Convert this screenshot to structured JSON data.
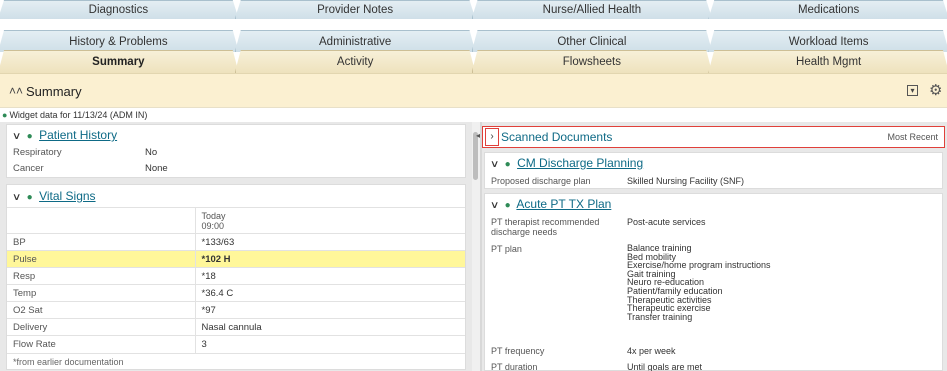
{
  "tabs": {
    "row1": [
      "Diagnostics",
      "Provider Notes",
      "Nurse/Allied Health",
      "Medications"
    ],
    "row2": [
      "History & Problems",
      "Administrative",
      "Other Clinical",
      "Workload Items"
    ],
    "row3": [
      "Summary",
      "Activity",
      "Flowsheets",
      "Health Mgmt"
    ]
  },
  "summary": {
    "title": "Summary",
    "collapse_icon": "chevron-double-up-icon",
    "refresh_icon": "refresh-icon",
    "settings_icon": "gear-icon"
  },
  "widget_date": "Widget data for 11/13/24 (ADM IN)",
  "patient_history": {
    "title": "Patient History",
    "rows": [
      {
        "label": "Respiratory",
        "value": "No"
      },
      {
        "label": "Cancer",
        "value": "None"
      }
    ]
  },
  "vital_signs": {
    "title": "Vital Signs",
    "col_header_day": "Today",
    "col_header_time": "09:00",
    "rows": [
      {
        "label": "BP",
        "value": "*133/63"
      },
      {
        "label": "Pulse",
        "value": "*102 H"
      },
      {
        "label": "Resp",
        "value": "*18"
      },
      {
        "label": "Temp",
        "value": "*36.4 C"
      },
      {
        "label": "O2 Sat",
        "value": "*97"
      },
      {
        "label": "Delivery",
        "value": "Nasal cannula"
      },
      {
        "label": "Flow Rate",
        "value": "3"
      }
    ],
    "footnote": "*from earlier documentation"
  },
  "scanned_documents": {
    "title": "Scanned Documents",
    "sort_label": "Most Recent"
  },
  "cm_discharge": {
    "title": "CM Discharge Planning",
    "label": "Proposed discharge plan",
    "value": "Skilled Nursing Facility (SNF)"
  },
  "acute_pt": {
    "title": "Acute PT TX Plan",
    "needs_label": "PT therapist recommended discharge needs",
    "needs_value": "Post-acute services",
    "plan_label": "PT plan",
    "plan_items": [
      "Balance training",
      "Bed mobility",
      "Exercise/home program instructions",
      "Gait training",
      "Neuro re-education",
      "Patient/family education",
      "Therapeutic activities",
      "Therapeutic exercise",
      "Transfer training"
    ],
    "frequency_label": "PT frequency",
    "frequency_value": "4x per week",
    "duration_label": "PT duration",
    "duration_value": "Until goals are met"
  },
  "colors": {
    "tab_blue": "#d6e4ec",
    "tab_yellow": "#f4e7c1",
    "summary_bar": "#fbf0d1",
    "link": "#0e6a86",
    "alert": "#fff79a",
    "highlight_border": "#e0403a"
  }
}
